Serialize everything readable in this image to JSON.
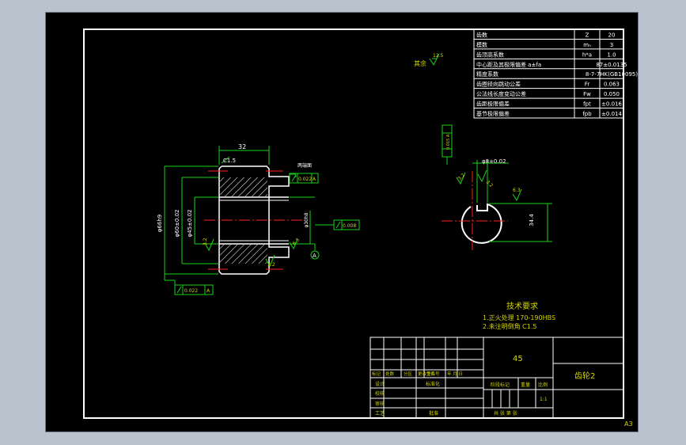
{
  "gear_params": [
    {
      "name": "齿数",
      "symbol": "Z",
      "value": "20"
    },
    {
      "name": "模数",
      "symbol": "mₙ",
      "value": "3"
    },
    {
      "name": "齿顶高系数",
      "symbol": "h*a",
      "value": "1.0"
    },
    {
      "name": "中心距及其极限偏差 a±fa",
      "symbol": "",
      "value": "87±0.0135"
    },
    {
      "name": "精度系数",
      "symbol": "",
      "value": "8-7-7HK(GB10095)"
    },
    {
      "name": "齿圈径向跳动公差",
      "symbol": "Fr",
      "value": "0.063"
    },
    {
      "name": "公法线长度变动公差",
      "symbol": "Fw",
      "value": "0.050"
    },
    {
      "name": "齿距极限偏差",
      "symbol": "fpt",
      "value": "±0.016"
    },
    {
      "name": "基节极限偏差",
      "symbol": "fpb",
      "value": "±0.014"
    }
  ],
  "surface_other": "其余",
  "roughness_other": "12.5",
  "front_view": {
    "dim_width": "32",
    "chamfer": "C1.5",
    "dia_tip": "φ66h9",
    "dia_root": "φ60±0.02",
    "dia_bore": "φ45±0.02",
    "dia_30": "φ30h8",
    "rough_32a": "3.2",
    "rough_32b": "3.2",
    "rough_63": "6.3",
    "note_both_ends": "两端面",
    "tol_box_1_value": "0.022",
    "tol_box_1_datum": "A",
    "tol_box_2_value": "0.008",
    "tol_box_3_value": "0.022",
    "tol_box_3_datum": "A",
    "datum_label": "A"
  },
  "side_view": {
    "keyway_width": "φ8±0.02",
    "keyway_depth": "34.4",
    "rough_32a": "3.2",
    "rough_32b": "3.2",
    "rough_63": "6.3",
    "vertical_tol": "0.015 A"
  },
  "tech_req": {
    "title": "技术要求",
    "line1": "1.正火处理 170-190HBS",
    "line2": "2.未注明倒角 C1.5"
  },
  "title_block": {
    "material": "45",
    "part_name": "齿轮2",
    "row_labels": [
      "标记",
      "处数",
      "分区",
      "更改文件号",
      "签名",
      "年 月 日"
    ],
    "label_design": "设计",
    "label_std": "标准化",
    "label_check": "校核",
    "label_review": "审核",
    "label_craft": "工艺",
    "label_approve": "批准",
    "stage_mark": "阶段标记",
    "weight": "重量",
    "scale": "比例",
    "scale_value": "1:1",
    "sheets": "共   张   第   张"
  },
  "sheet_size": "A3"
}
